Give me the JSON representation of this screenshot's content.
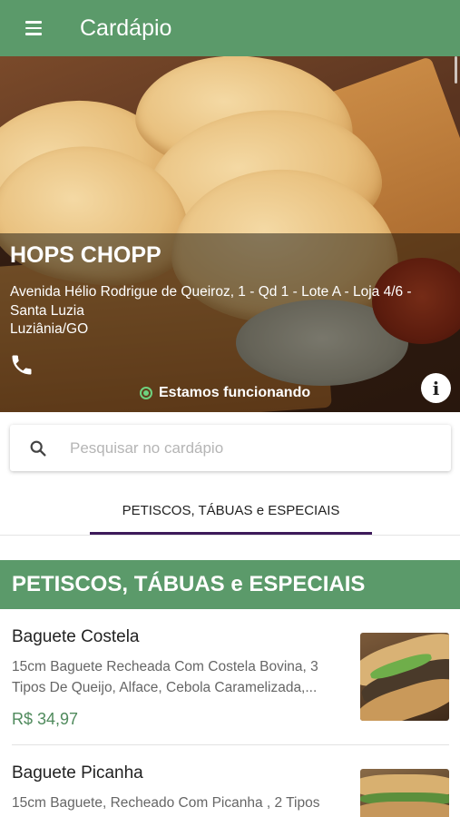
{
  "appbar": {
    "title": "Cardápio",
    "menu_icon": "menu-icon"
  },
  "store": {
    "name": "HOPS CHOPP",
    "address": "Avenida Hélio Rodrigue de Queiroz, 1 - Qd 1 - Lote A - Loja 4/6 - Santa Luzia",
    "city": "Luziânia/GO",
    "status": "Estamos funcionando",
    "status_color": "#6fd27f"
  },
  "search": {
    "placeholder": "Pesquisar no cardápio",
    "value": ""
  },
  "tabs": [
    {
      "label": "PETISCOS, TÁBUAS e ESPECIAIS",
      "selected": true
    }
  ],
  "section": {
    "title": "PETISCOS, TÁBUAS e ESPECIAIS"
  },
  "items": [
    {
      "name": "Baguete Costela",
      "description": "15cm Baguete Recheada Com Costela Bovina, 3 Tipos De Queijo, Alface, Cebola Caramelizada,...",
      "price": "R$ 34,97"
    },
    {
      "name": "Baguete Picanha",
      "description": "15cm Baguete, Recheado Com Picanha , 2 Tipos"
    }
  ],
  "colors": {
    "primary": "#5b9a6a",
    "tab_indicator": "#3d1a5a",
    "price": "#4f8a5c"
  }
}
